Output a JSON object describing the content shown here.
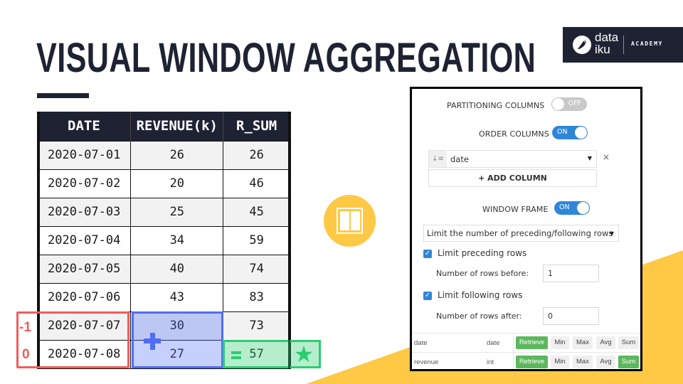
{
  "slide": {
    "title": "VISUAL WINDOW AGGREGATION",
    "colors": {
      "navy": "#1e2233",
      "accent_yellow": "#ffc845",
      "highlight_red": "#f25c5c",
      "highlight_blue": "#4f6ef5",
      "highlight_green": "#2ecc71",
      "toggle_blue": "#2f86d8",
      "button_green": "#5cb85c"
    }
  },
  "logo": {
    "wordmark_line1": "data",
    "wordmark_line2": "iku",
    "subtitle": "ACADEMY",
    "icon": "bird-icon"
  },
  "table": {
    "headers": [
      "DATE",
      "REVENUE(k)",
      "R_SUM"
    ],
    "rows": [
      [
        "2020-07-01",
        "26",
        "26"
      ],
      [
        "2020-07-02",
        "20",
        "46"
      ],
      [
        "2020-07-03",
        "25",
        "45"
      ],
      [
        "2020-07-04",
        "34",
        "59"
      ],
      [
        "2020-07-05",
        "40",
        "74"
      ],
      [
        "2020-07-06",
        "43",
        "83"
      ],
      [
        "2020-07-07",
        "30",
        "73"
      ],
      [
        "2020-07-08",
        "27",
        "57"
      ]
    ]
  },
  "annotations": {
    "offset_preceding": "-1",
    "offset_current": "0",
    "plus_icon": "plus-icon",
    "equals_icon": "equals-icon",
    "star": "★",
    "result_value": "57"
  },
  "center_icon": "window-icon",
  "panel": {
    "partitioning": {
      "label": "PARTITIONING COLUMNS",
      "state": "OFF"
    },
    "order": {
      "label": "ORDER COLUMNS",
      "state": "ON",
      "column": "date",
      "sort_icon": "sort-ascending-icon",
      "remove": "×",
      "add_button": "+ ADD COLUMN"
    },
    "window_frame": {
      "label": "WINDOW FRAME",
      "state": "ON",
      "mode": "Limit the number of preceding/following rows",
      "limit_preceding": {
        "label": "Limit preceding rows",
        "checked": true,
        "field_label": "Number of rows before:",
        "value": "1"
      },
      "limit_following": {
        "label": "Limit following rows",
        "checked": true,
        "field_label": "Number of rows after:",
        "value": "0"
      }
    },
    "aggregations": [
      {
        "name": "date",
        "type": "date",
        "buttons": [
          {
            "label": "Retrieve",
            "active": true
          },
          {
            "label": "Min",
            "active": false
          },
          {
            "label": "Max",
            "active": false
          },
          {
            "label": "Avg",
            "active": false
          },
          {
            "label": "Sum",
            "active": false
          }
        ]
      },
      {
        "name": "revenue",
        "type": "int",
        "buttons": [
          {
            "label": "Retrieve",
            "active": true
          },
          {
            "label": "Min",
            "active": false
          },
          {
            "label": "Max",
            "active": false
          },
          {
            "label": "Avg",
            "active": false
          },
          {
            "label": "Sum",
            "active": true
          }
        ]
      }
    ]
  }
}
